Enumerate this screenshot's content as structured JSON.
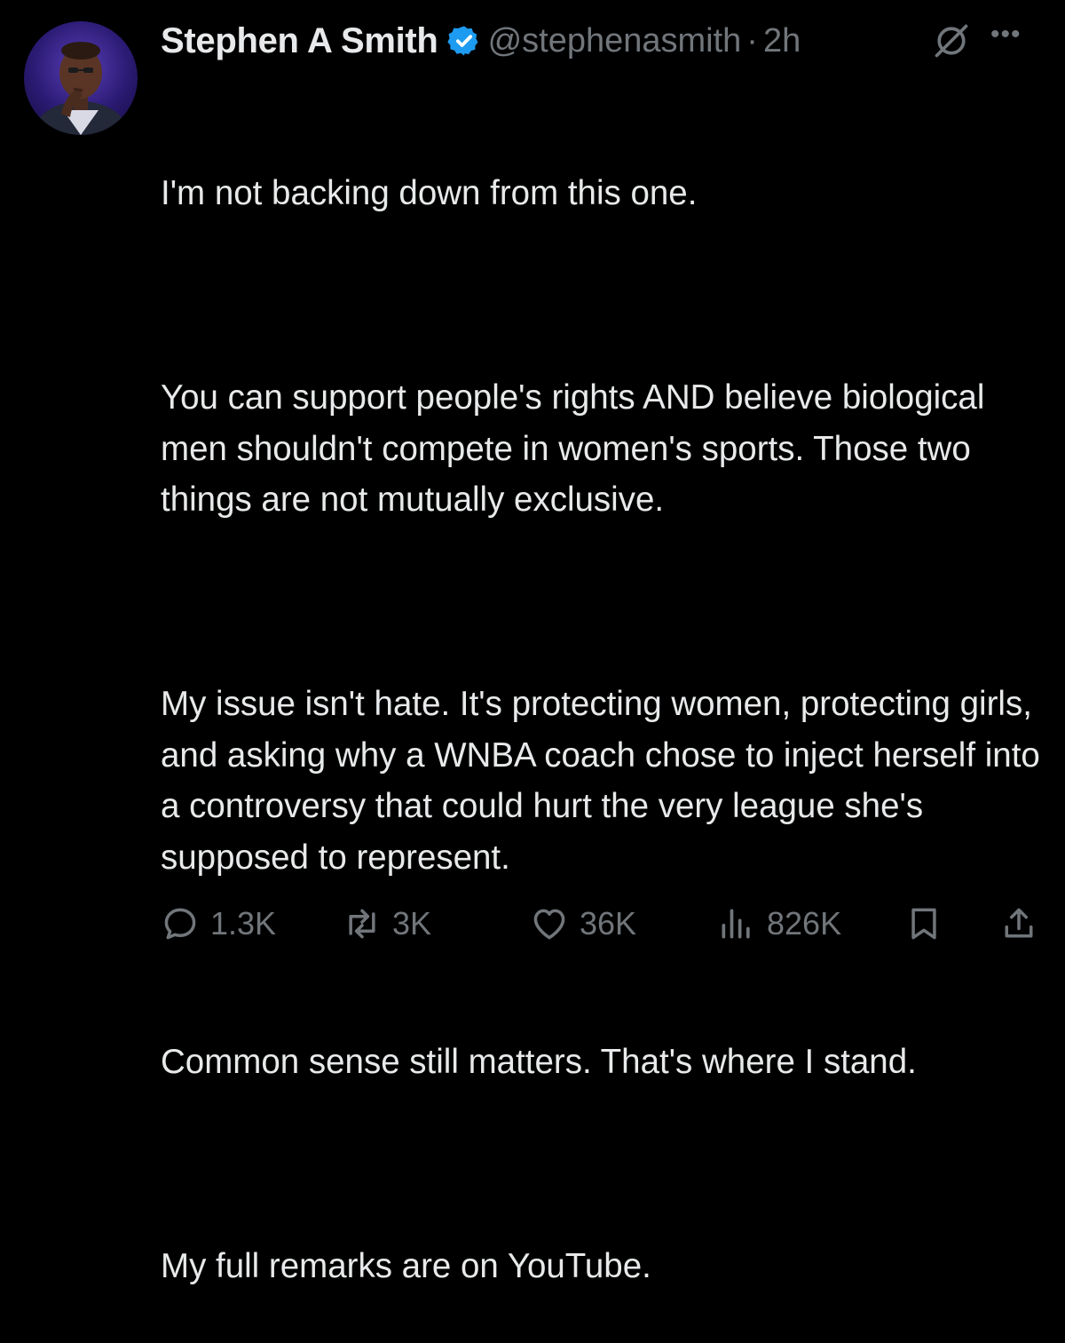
{
  "author": {
    "name": "Stephen A Smith",
    "handle": "@stephenasmith",
    "separator": "·",
    "time": "2h",
    "verified": true
  },
  "tweet": {
    "paragraphs": [
      "I'm not backing down from this one.",
      "You can support people's rights AND believe biological men shouldn't compete in women's sports. Those two things are not mutually exclusive.",
      "My issue isn't hate. It's protecting women, protecting girls, and asking why a WNBA coach chose to inject herself into a controversy that could hurt the very league she's supposed to represent.",
      "Common sense still matters. That's where I stand.",
      "My full remarks are on YouTube."
    ]
  },
  "actions": {
    "replies": "1.3K",
    "reposts": "3K",
    "likes": "36K",
    "views": "826K"
  },
  "icons": {
    "verified": "verified-badge-icon",
    "grok": "grok-icon",
    "more": "more-icon",
    "reply": "reply-icon",
    "repost": "repost-icon",
    "like": "heart-icon",
    "views": "views-icon",
    "bookmark": "bookmark-icon",
    "share": "share-icon"
  },
  "colors": {
    "background": "#000000",
    "text": "#e7e9ea",
    "muted": "#71767b",
    "verified": "#1d9bf0"
  }
}
